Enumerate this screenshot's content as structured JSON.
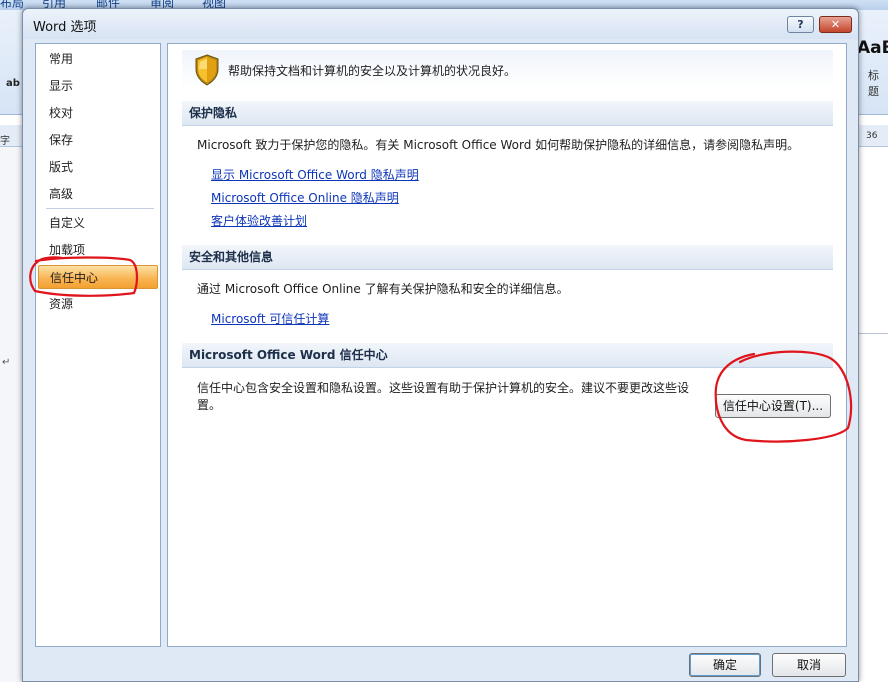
{
  "background_app": {
    "ribbon_tabs": [
      "布局",
      "引用",
      "邮件",
      "审阅",
      "视图"
    ],
    "style_preview": "AaB",
    "style_name": "标题",
    "left_label": "ab",
    "small_label": "字",
    "ruler_number": "36",
    "paragraph_mark": "↵"
  },
  "dialog": {
    "title": "Word 选项",
    "help_label": "?",
    "close_label": "✕"
  },
  "nav": {
    "items": [
      {
        "label": "常用"
      },
      {
        "label": "显示"
      },
      {
        "label": "校对"
      },
      {
        "label": "保存"
      },
      {
        "label": "版式"
      },
      {
        "label": "高级"
      },
      {
        "label": "自定义"
      },
      {
        "label": "加载项"
      },
      {
        "label": "信任中心"
      },
      {
        "label": "资源"
      }
    ],
    "selected": "信任中心"
  },
  "content": {
    "header_icon": "shield-icon",
    "header_text": "帮助保持文档和计算机的安全以及计算机的状况良好。",
    "privacy": {
      "title": "保护隐私",
      "description": "Microsoft 致力于保护您的隐私。有关 Microsoft Office Word 如何帮助保护隐私的详细信息，请参阅隐私声明。",
      "links": [
        "显示 Microsoft Office Word 隐私声明",
        "Microsoft Office Online 隐私声明",
        "客户体验改善计划"
      ]
    },
    "security": {
      "title": "安全和其他信息",
      "description": "通过 Microsoft Office Online 了解有关保护隐私和安全的详细信息。",
      "link": "Microsoft 可信任计算"
    },
    "trust_center": {
      "title": "Microsoft Office Word 信任中心",
      "description_line1": "信任中心包含安全设置和隐私设置。这些设置有助于保护计算机的安全。建议不要更改这些设",
      "description_line2": "置。",
      "button_label": "信任中心设置(T)..."
    }
  },
  "buttons": {
    "ok": "确定",
    "cancel": "取消"
  },
  "colors": {
    "selected_nav_bg": "#f9b655",
    "link": "#0d35b8",
    "annotation_red": "#e0141b"
  }
}
